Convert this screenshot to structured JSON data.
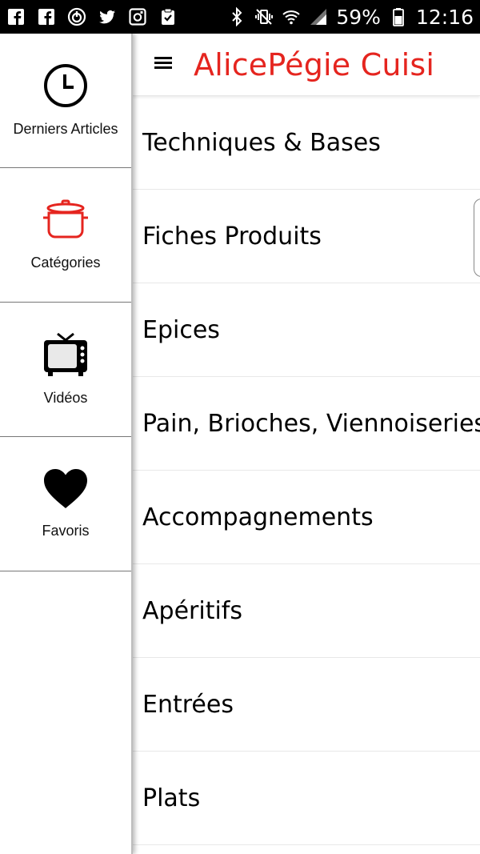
{
  "status_bar": {
    "battery": "59%",
    "time": "12:16",
    "icons": [
      "facebook-icon",
      "facebook-icon",
      "power-icon",
      "twitter-icon",
      "instagram-icon",
      "clipboard-check-icon",
      "bluetooth-icon",
      "vibrate-mute-icon",
      "wifi-icon",
      "signal-icon",
      "battery-icon"
    ]
  },
  "header": {
    "title": "AlicePégie Cuisi",
    "title_color": "#e5251f"
  },
  "sidebar": {
    "items": [
      {
        "label": "Derniers Articles",
        "icon": "clock-icon"
      },
      {
        "label": "Catégories",
        "icon": "cooking-pot-icon",
        "accent": "#e5251f"
      },
      {
        "label": "Vidéos",
        "icon": "tv-icon"
      },
      {
        "label": "Favoris",
        "icon": "heart-icon"
      }
    ]
  },
  "categories": [
    "Techniques & Bases",
    "Fiches Produits",
    "Epices",
    "Pain, Brioches, Viennoiseries",
    "Accompagnements",
    "Apéritifs",
    "Entrées",
    "Plats"
  ]
}
